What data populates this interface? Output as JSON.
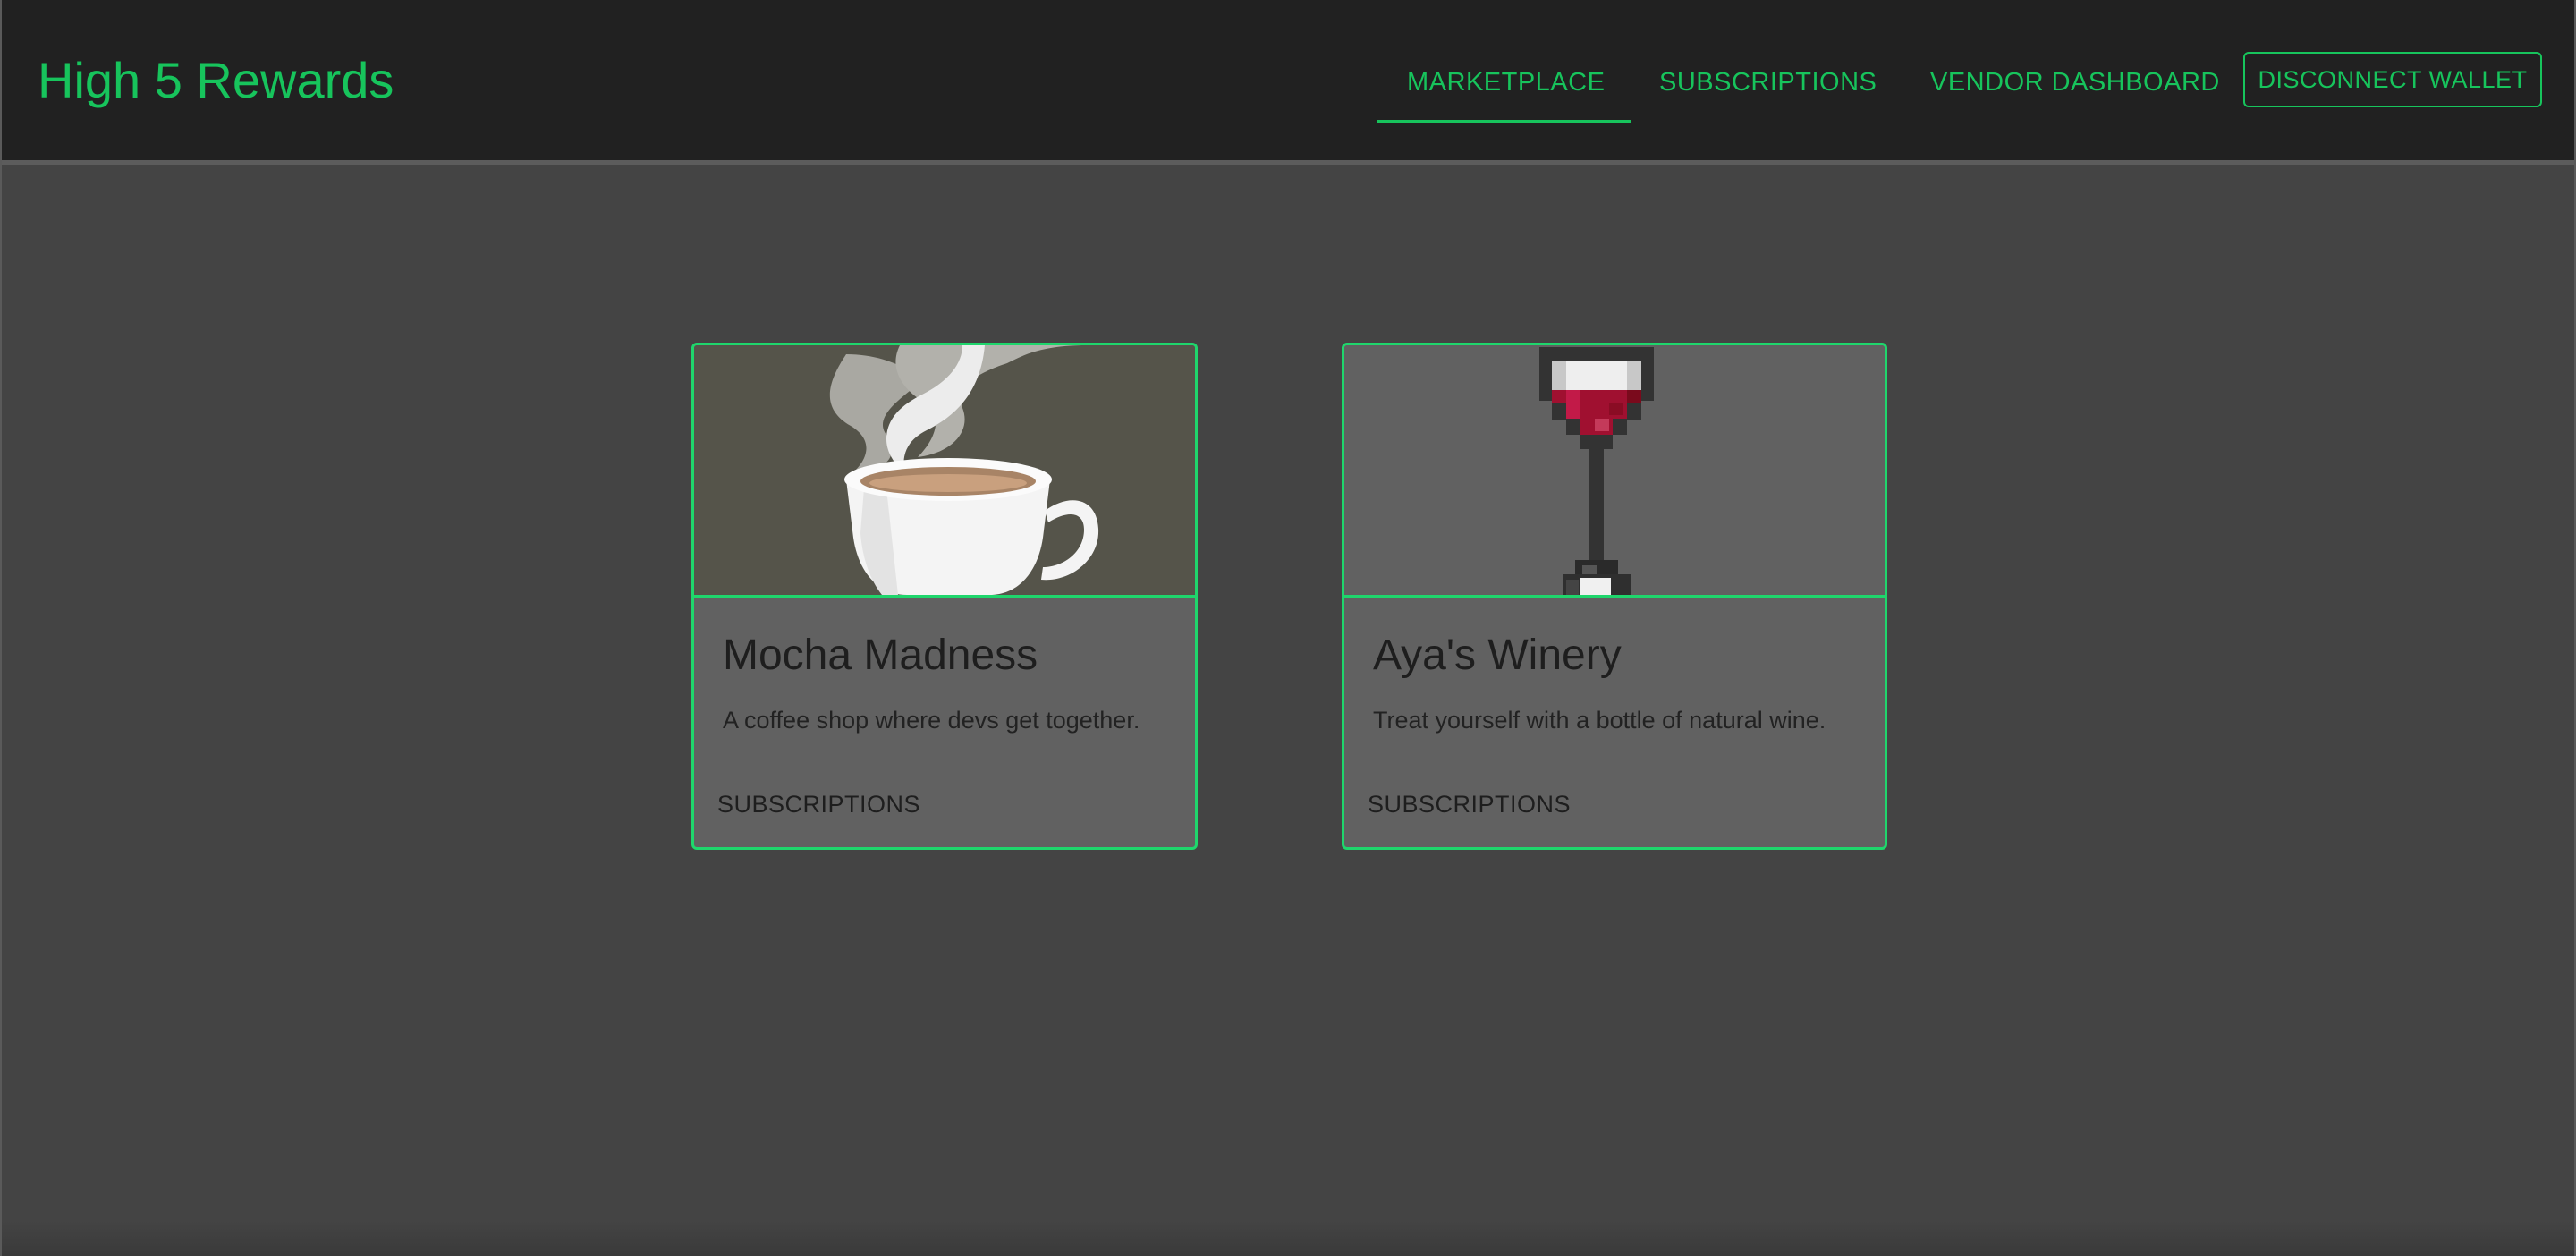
{
  "app": {
    "title": "High 5 Rewards"
  },
  "nav": {
    "items": [
      {
        "label": "MARKETPLACE",
        "active": true
      },
      {
        "label": "SUBSCRIPTIONS",
        "active": false
      },
      {
        "label": "VENDOR DASHBOARD",
        "active": false
      }
    ],
    "wallet_button": "DISCONNECT WALLET"
  },
  "vendors": [
    {
      "name": "Mocha Madness",
      "description": "A coffee shop where devs get together.",
      "action": "SUBSCRIPTIONS",
      "image_icon": "coffee-cup-icon"
    },
    {
      "name": "Aya's Winery",
      "description": "Treat yourself with a bottle of natural wine.",
      "action": "SUBSCRIPTIONS",
      "image_icon": "wine-glass-icon"
    }
  ],
  "colors": {
    "accent": "#17c45c",
    "card_border": "#1fd66c",
    "appbar_bg": "#212121",
    "page_bg": "#444444",
    "card_bg": "#616161"
  }
}
